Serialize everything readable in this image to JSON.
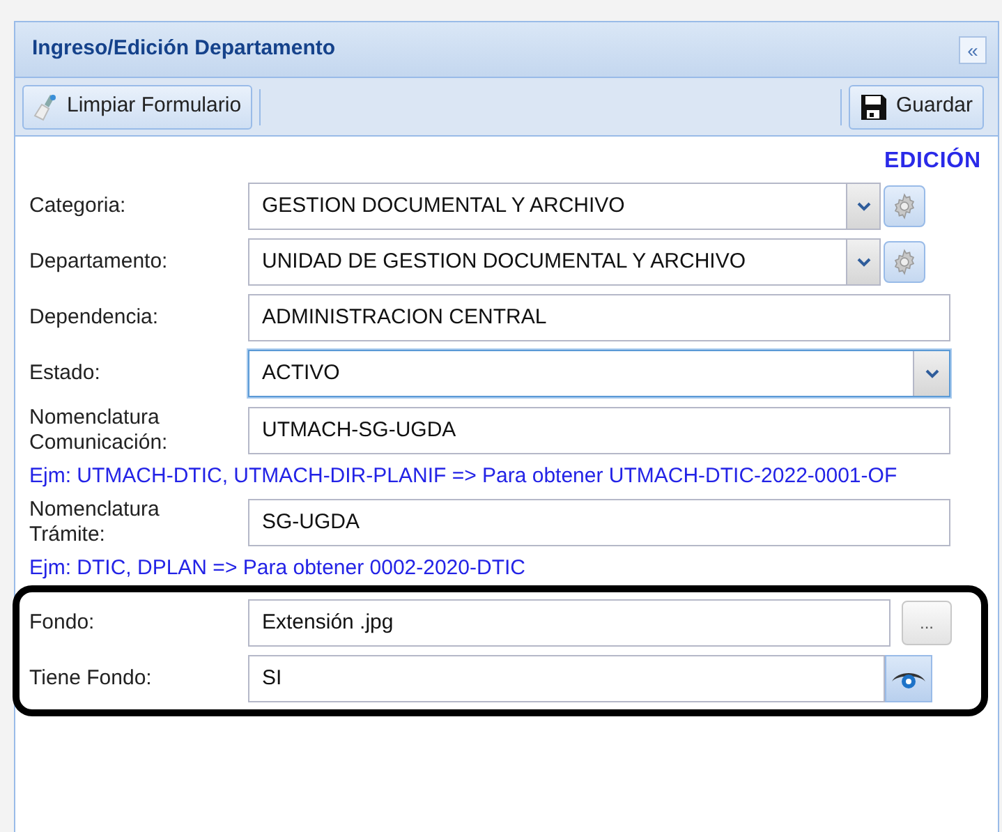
{
  "panel": {
    "title": "Ingreso/Edición Departamento",
    "collapse_button": "«"
  },
  "toolbar": {
    "buttons": [
      {
        "label": "Limpiar Formulario",
        "kind": "clear"
      },
      {
        "label": "Guardar",
        "kind": "save"
      }
    ]
  },
  "mode": "EDICIÓN",
  "rows": [
    {
      "kind": "combo_gear",
      "label": "Categoria:",
      "value": "GESTION DOCUMENTAL Y ARCHIVO"
    },
    {
      "kind": "combo_gear",
      "label": "Departamento:",
      "value": "UNIDAD DE GESTION DOCUMENTAL Y ARCHIVO"
    },
    {
      "kind": "text",
      "label": "Dependencia:",
      "value": "ADMINISTRACION CENTRAL"
    },
    {
      "kind": "combo",
      "label": "Estado:",
      "value": "ACTIVO",
      "focused": true
    },
    {
      "kind": "text",
      "label": "Nomenclatura Comunicación:",
      "value": "UTMACH-SG-UGDA"
    },
    {
      "kind": "hint",
      "text": "Ejm: UTMACH-DTIC, UTMACH-DIR-PLANIF => Para obtener UTMACH-DTIC-2022-0001-OF"
    },
    {
      "kind": "text",
      "label": "Nomenclatura Trámite:",
      "value": "SG-UGDA"
    },
    {
      "kind": "hint",
      "text": "Ejm: DTIC, DPLAN => Para obtener 0002-2020-DTIC"
    }
  ],
  "highlighted_rows": [
    {
      "kind": "file",
      "label": "Fondo:",
      "placeholder": "Extensión .jpg",
      "button": "..."
    },
    {
      "kind": "text_eye",
      "label": "Tiene Fondo:",
      "value": "SI"
    }
  ]
}
